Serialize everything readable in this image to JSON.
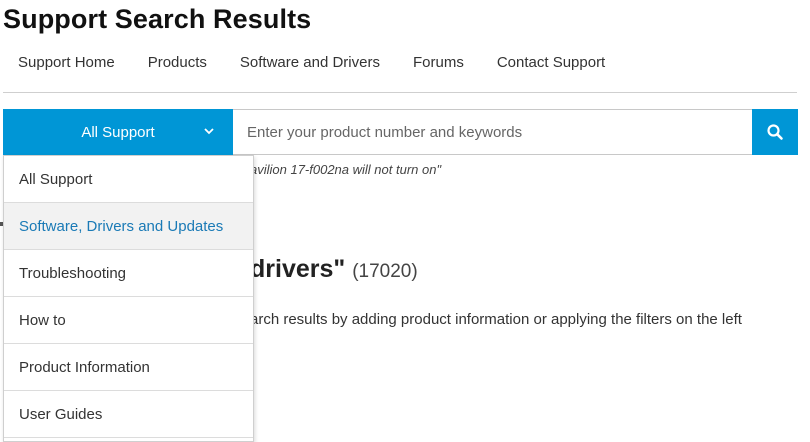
{
  "page": {
    "title": "Support Search Results"
  },
  "nav": {
    "items": [
      {
        "label": "Support Home"
      },
      {
        "label": "Products"
      },
      {
        "label": "Software and Drivers"
      },
      {
        "label": "Forums"
      },
      {
        "label": "Contact Support"
      }
    ]
  },
  "search": {
    "scope_label": "All Support",
    "placeholder": "Enter your product number and keywords",
    "value": "",
    "hint": "avilion 17-f002na will not turn on\""
  },
  "dropdown": {
    "items": [
      {
        "label": "All Support"
      },
      {
        "label": "Software, Drivers and Updates",
        "active": true
      },
      {
        "label": "Troubleshooting"
      },
      {
        "label": "How to"
      },
      {
        "label": "Product Information"
      },
      {
        "label": "User Guides"
      }
    ]
  },
  "results": {
    "heading_visible": "drivers\"",
    "count": "(17020)",
    "subtext": "arch results by adding product information or applying the filters on the left"
  },
  "colors": {
    "accent": "#0096d6",
    "active_text": "#1a7ab6"
  },
  "icons": {
    "scope_chevron": "chevron-down-icon",
    "search": "search-icon"
  }
}
